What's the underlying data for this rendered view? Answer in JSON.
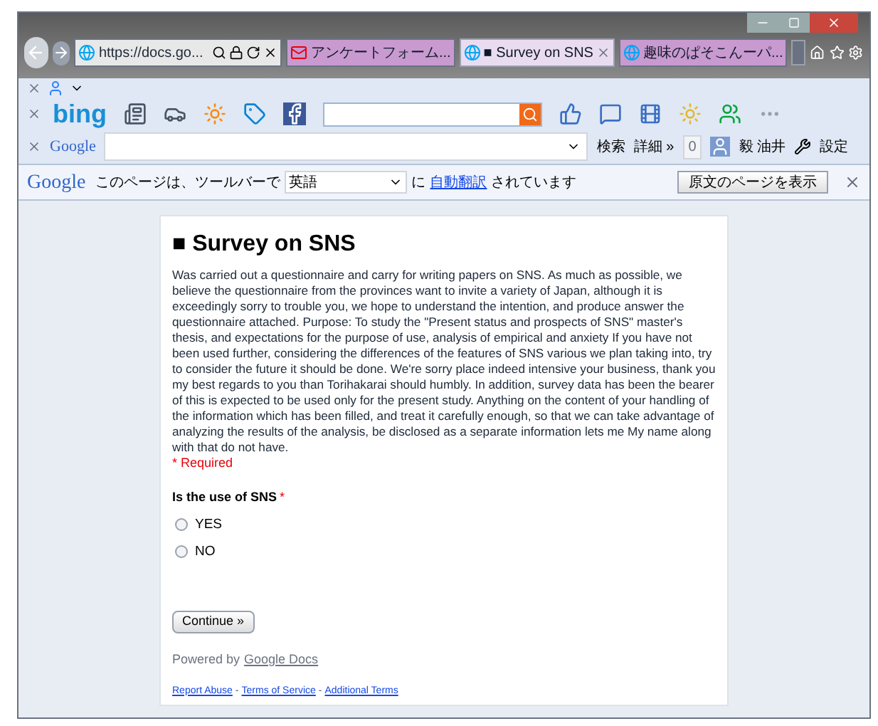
{
  "address_bar": {
    "url": "https://docs.go..."
  },
  "tabs": [
    {
      "label": "アンケートフォーム...",
      "selected": false,
      "kind": "mail"
    },
    {
      "label": "■ Survey on SNS",
      "selected": true,
      "kind": "ie"
    },
    {
      "label": "趣味のぱそこんーパ...",
      "selected": false,
      "kind": "ie"
    }
  ],
  "bing_toolbar": {
    "logo": "bing"
  },
  "google_toolbar": {
    "logo": "Google",
    "search_button": "検索",
    "more_button": "詳細 »",
    "count": "0",
    "user": "毅 油井",
    "settings": "設定"
  },
  "translate_bar": {
    "logo": "Google",
    "text_before": "このページは、ツールバーで",
    "language": "英語",
    "text_middle": "に",
    "link": "自動翻訳",
    "text_after": "されています",
    "button": "原文のページを表示"
  },
  "form": {
    "title": "■ Survey on SNS",
    "description": "Was carried out a questionnaire and carry for writing papers on SNS. As much as possible, we believe the questionnaire from the provinces want to invite a variety of Japan, although it is exceedingly sorry to trouble you, we hope to understand the intention, and produce answer the questionnaire attached. Purpose: To study the \"Present status and prospects of SNS\" master's thesis, and expectations for the purpose of use, analysis of empirical and anxiety If you have not been used further, considering the differences of the features of SNS various we plan taking into, try to consider the future it should be done. We're sorry place indeed intensive your business, thank you my best regards to you than Torihakarai should humbly. In addition, survey data has been the bearer of this is expected to be used only for the present study. Anything on the content of your handling of the information which has been filled, and treat it carefully enough, so that we can take advantage of analyzing the results of the analysis, be disclosed as a separate information lets me My name along with that do not have.",
    "required_note": "* Required",
    "question": {
      "label": "Is the use of SNS",
      "required_mark": "*"
    },
    "options": [
      {
        "label": "YES",
        "selected": false
      },
      {
        "label": "NO",
        "selected": false
      }
    ],
    "continue_button": "Continue »",
    "powered_by": "Powered by",
    "powered_link": "Google Docs",
    "footer_links": [
      "Report Abuse",
      "Terms of Service",
      "Additional Terms"
    ],
    "separator": "-"
  }
}
